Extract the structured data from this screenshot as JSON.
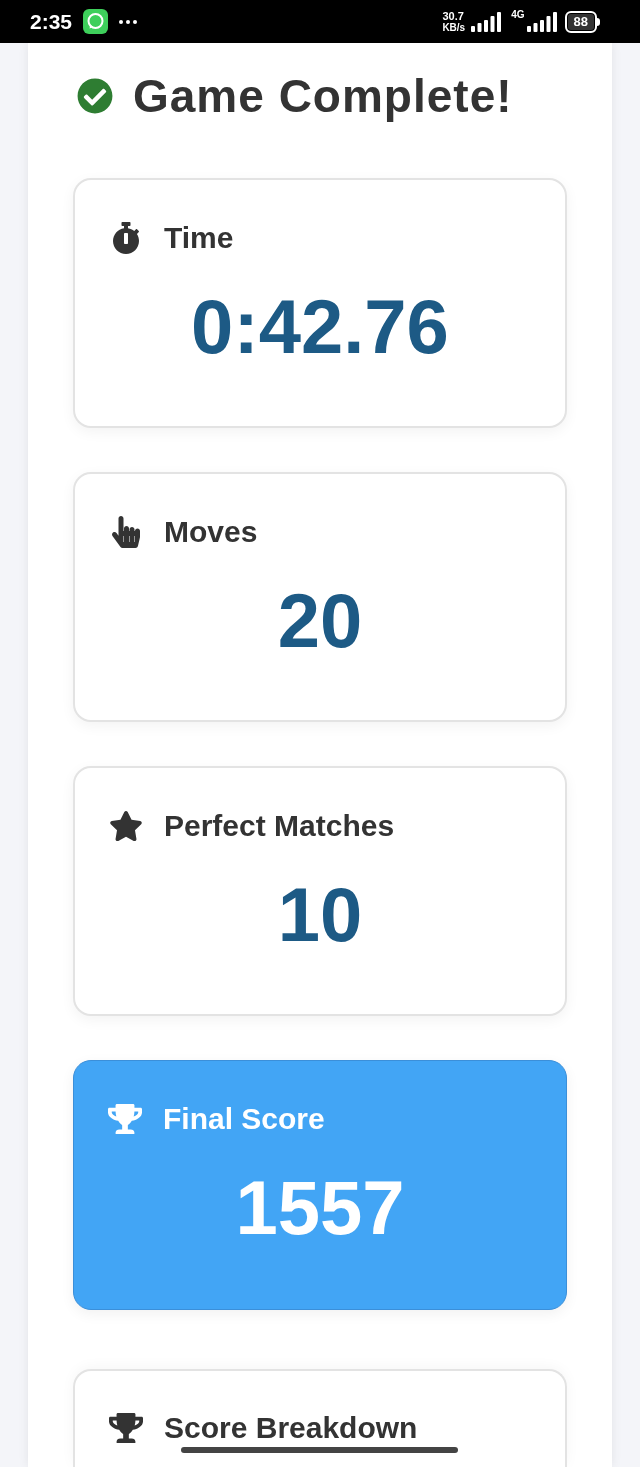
{
  "status_bar": {
    "time": "2:35",
    "net_speed": "30.7",
    "net_speed_unit": "KB/s",
    "network_type": "4G",
    "battery": "88"
  },
  "header": {
    "title": "Game Complete!"
  },
  "stats": [
    {
      "kind": "time",
      "label": "Time",
      "value": "0:42.76",
      "highlighted": false
    },
    {
      "kind": "moves",
      "label": "Moves",
      "value": "20",
      "highlighted": false
    },
    {
      "kind": "matches",
      "label": "Perfect Matches",
      "value": "10",
      "highlighted": false
    },
    {
      "kind": "score",
      "label": "Final Score",
      "value": "1557",
      "highlighted": true
    }
  ],
  "breakdown": {
    "title": "Score Breakdown"
  }
}
